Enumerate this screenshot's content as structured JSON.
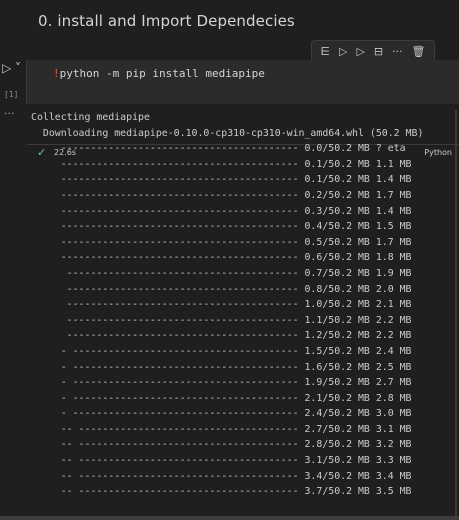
{
  "markdown": {
    "heading": "0. install and Import Dependecies"
  },
  "toolbar": {
    "icons": [
      "run-by-line-icon",
      "execute-above-icon",
      "execute-below-icon",
      "split-cell-icon",
      "more-icon",
      "delete-icon"
    ],
    "glyphs": [
      "⋿",
      "▷",
      "▷",
      "⊟",
      "···",
      "🗑"
    ]
  },
  "cell": {
    "run_glyph": "▷ ˅",
    "exec_count": "[1]",
    "code_bang": "!",
    "code_rest": "python -m pip install mediapipe",
    "duration": "22.6s",
    "kernel": "Python"
  },
  "output": {
    "dots": "···",
    "lines": [
      "Collecting mediapipe",
      "  Downloading mediapipe-0.10.0-cp310-cp310-win_amd64.whl (50.2 MB)",
      "     ---------------------------------------- 0.0/50.2 MB ? eta",
      "     ---------------------------------------- 0.1/50.2 MB 1.1 MB",
      "     ---------------------------------------- 0.1/50.2 MB 1.4 MB",
      "     ---------------------------------------- 0.2/50.2 MB 1.7 MB",
      "     ---------------------------------------- 0.3/50.2 MB 1.4 MB",
      "     ---------------------------------------- 0.4/50.2 MB 1.5 MB",
      "     ---------------------------------------- 0.5/50.2 MB 1.7 MB",
      "     ---------------------------------------- 0.6/50.2 MB 1.8 MB",
      "      --------------------------------------- 0.7/50.2 MB 1.9 MB",
      "      --------------------------------------- 0.8/50.2 MB 2.0 MB",
      "      --------------------------------------- 1.0/50.2 MB 2.1 MB",
      "      --------------------------------------- 1.1/50.2 MB 2.2 MB",
      "      --------------------------------------- 1.2/50.2 MB 2.2 MB",
      "     - -------------------------------------- 1.5/50.2 MB 2.4 MB",
      "     - -------------------------------------- 1.6/50.2 MB 2.5 MB",
      "     - -------------------------------------- 1.9/50.2 MB 2.7 MB",
      "     - -------------------------------------- 2.1/50.2 MB 2.8 MB",
      "     - -------------------------------------- 2.4/50.2 MB 3.0 MB",
      "     -- ------------------------------------- 2.7/50.2 MB 3.1 MB",
      "     -- ------------------------------------- 2.8/50.2 MB 3.2 MB",
      "     -- ------------------------------------- 3.1/50.2 MB 3.3 MB",
      "     -- ------------------------------------- 3.4/50.2 MB 3.4 MB",
      "     -- ------------------------------------- 3.7/50.2 MB 3.5 MB"
    ]
  },
  "colors": {
    "background": "#1f1f1f",
    "cell": "#2b2b2b",
    "bang": "#e6524e",
    "success": "#73c991"
  }
}
